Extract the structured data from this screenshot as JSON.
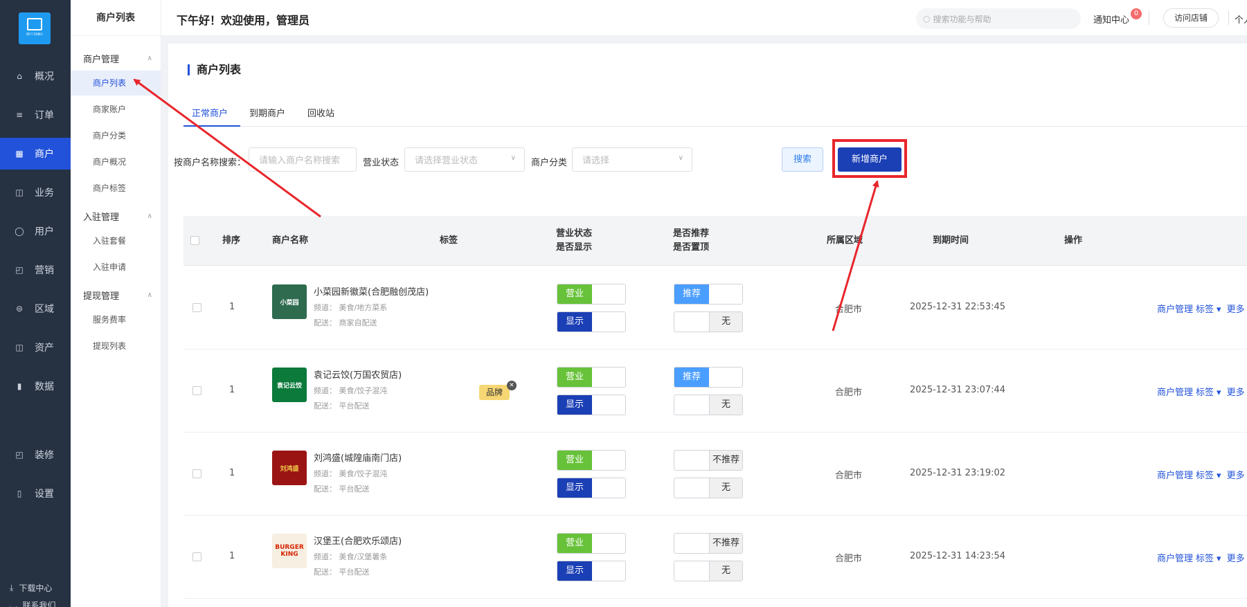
{
  "nav": {
    "logo_text": "商户门店展示",
    "items": [
      {
        "label": "概况",
        "icon": "chart-icon"
      },
      {
        "label": "订单",
        "icon": "document-icon"
      },
      {
        "label": "商户",
        "icon": "store-icon"
      },
      {
        "label": "业务",
        "icon": "briefcase-icon"
      },
      {
        "label": "用户",
        "icon": "user-icon"
      },
      {
        "label": "营销",
        "icon": "bag-icon"
      },
      {
        "label": "区域",
        "icon": "database-icon"
      },
      {
        "label": "资产",
        "icon": "wallet-icon"
      },
      {
        "label": "数据",
        "icon": "bar-chart-icon"
      },
      {
        "label": "装修",
        "icon": "brush-icon"
      },
      {
        "label": "设置",
        "icon": "settings-icon"
      }
    ],
    "active": "商户",
    "bottom": [
      {
        "label": "下载中心",
        "icon": "download-icon"
      },
      {
        "label": "联系我们",
        "icon": "headset-icon"
      }
    ]
  },
  "subnav": {
    "title": "商户列表",
    "groups": [
      {
        "label": "商户管理",
        "items": [
          "商户列表",
          "商家账户",
          "商户分类",
          "商户概况",
          "商户标签"
        ]
      },
      {
        "label": "入驻管理",
        "items": [
          "入驻套餐",
          "入驻申请"
        ]
      },
      {
        "label": "提现管理",
        "items": [
          "服务费率",
          "提现列表"
        ]
      }
    ],
    "active": "商户列表"
  },
  "header": {
    "greeting": "下午好！欢迎使用，管理员",
    "search_placeholder": "搜索功能与帮助",
    "notice_label": "通知中心",
    "notice_count": "0",
    "visit_label": "访问店铺",
    "personal_label": "个人"
  },
  "page": {
    "title": "商户列表",
    "tabs": [
      "正常商户",
      "到期商户",
      "回收站"
    ],
    "active_tab": "正常商户",
    "filters": {
      "name_label": "按商户名称搜索：",
      "name_placeholder": "请输入商户名称搜索",
      "status_label": "营业状态",
      "status_placeholder": "请选择营业状态",
      "category_label": "商户分类",
      "category_placeholder": "请选择",
      "search_button": "搜索",
      "add_button": "新增商户"
    }
  },
  "table": {
    "columns": {
      "sort": "排序",
      "name": "商户名称",
      "tags": "标签",
      "status1": "营业状态",
      "status2": "是否显示",
      "recommend1": "是否推荐",
      "recommend2": "是否置顶",
      "region": "所属区域",
      "expire": "到期时间",
      "actions": "操作"
    },
    "rows": [
      {
        "sort": "1",
        "name": "小菜园新徽菜(合肥融创茂店)",
        "channel": "频道： 美食/地方菜系",
        "delivery": "配送： 商家自配送",
        "logo_text": "小菜园",
        "tag": "",
        "status": "营业",
        "display": "显示",
        "recommend": "推荐",
        "pin": "无",
        "region": "合肥市",
        "expire": "2025-12-31 22:53:45"
      },
      {
        "sort": "1",
        "name": "袁记云饺(万国农贸店)",
        "channel": "频道： 美食/饺子混沌",
        "delivery": "配送： 平台配送",
        "logo_text": "袁记云饺",
        "tag": "品牌",
        "status": "营业",
        "display": "显示",
        "recommend": "推荐",
        "pin": "无",
        "region": "合肥市",
        "expire": "2025-12-31 23:07:44"
      },
      {
        "sort": "1",
        "name": "刘鸿盛(城隍庙南门店)",
        "channel": "频道： 美食/饺子混沌",
        "delivery": "配送： 平台配送",
        "logo_text": "刘鸿盛",
        "tag": "",
        "status": "营业",
        "display": "显示",
        "recommend": "不推荐",
        "pin": "无",
        "region": "合肥市",
        "expire": "2025-12-31 23:19:02"
      },
      {
        "sort": "1",
        "name": "汉堡王(合肥欢乐颂店)",
        "channel": "频道： 美食/汉堡薯条",
        "delivery": "配送： 平台配送",
        "logo_text": "BURGER KING",
        "tag": "",
        "status": "营业",
        "display": "显示",
        "recommend": "不推荐",
        "pin": "无",
        "region": "合肥市",
        "expire": "2025-12-31 14:23:54"
      }
    ],
    "actions": {
      "manage": "商户管理",
      "tag": "标签",
      "more": "更多"
    }
  },
  "colors": {
    "accent": "#2152d9",
    "nav_bg": "#263142",
    "annotation": "#e8262b",
    "open_green": "#67c23a",
    "display_navy": "#1b3fb5",
    "recommend_blue": "#4a9eff"
  }
}
